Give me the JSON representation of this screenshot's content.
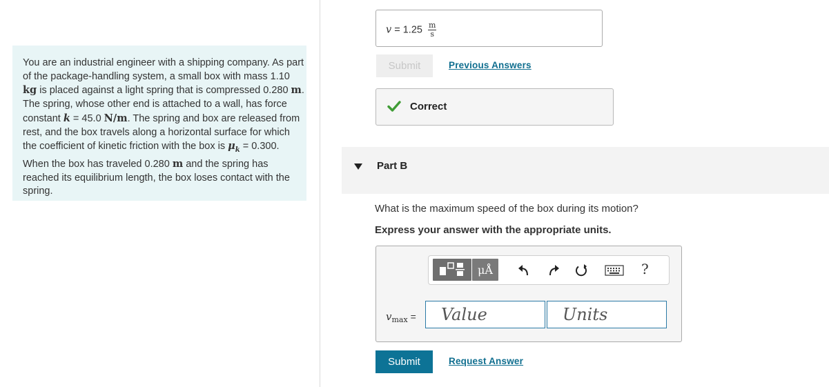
{
  "problem": {
    "segments": [
      {
        "t": "You are an industrial engineer with a shipping company. As part of the package-handling system, a small box with mass 1.10 "
      },
      {
        "u": "kg"
      },
      {
        "t": " is placed against a light spring that is compressed 0.280 "
      },
      {
        "u": "m"
      },
      {
        "t": ". The spring, whose other end is attached to a wall, has force constant "
      },
      {
        "v": "k"
      },
      {
        "t": " = 45.0 "
      },
      {
        "u": "N/m"
      },
      {
        "t": ". The spring and box are released from rest, and the box travels along a horizontal surface for which the coefficient of kinetic friction with the box is "
      },
      {
        "v": "μ"
      },
      {
        "sub": "k"
      },
      {
        "t": " = 0.300. When the box has traveled 0.280 "
      },
      {
        "u": "m"
      },
      {
        "t": " and the spring has reached its equilibrium length, the box loses contact with the spring."
      }
    ]
  },
  "part_a": {
    "answer_var": "v",
    "answer_eq": " = ",
    "answer_value": "1.25",
    "answer_unit_num": "m",
    "answer_unit_den": "s",
    "submit_label": "Submit",
    "previous_answers_label": "Previous Answers",
    "result_label": "Correct"
  },
  "part_b": {
    "title": "Part B",
    "question": "What is the maximum speed of the box during its motion?",
    "instruction": "Express your answer with the appropriate units.",
    "units_button_label": "μÅ",
    "help_label": "?",
    "var_label": "v",
    "var_sub": "max",
    "equals": " =",
    "value_placeholder": "Value",
    "units_placeholder": "Units",
    "submit_label": "Submit",
    "request_answer_label": "Request Answer"
  },
  "colors": {
    "accent": "#0d7396",
    "link": "#0f6e8f",
    "correct": "#3f9c35",
    "problem_bg": "#e8f5f6"
  },
  "icons": [
    "check-icon",
    "caret-down-icon",
    "templates-icon",
    "undo-icon",
    "redo-icon",
    "reset-icon",
    "keyboard-icon",
    "help-icon"
  ]
}
